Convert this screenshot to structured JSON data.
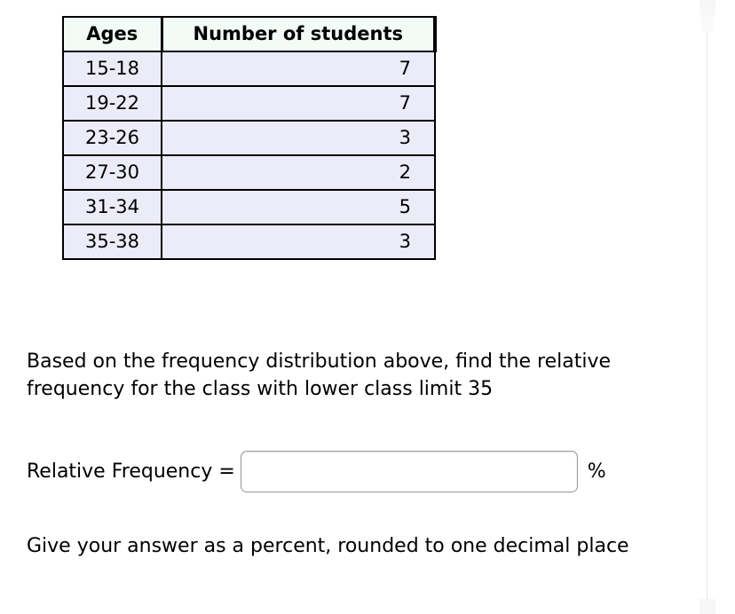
{
  "table": {
    "headers": [
      "Ages",
      "Number of students"
    ],
    "rows": [
      {
        "ages": "15-18",
        "count": "7"
      },
      {
        "ages": "19-22",
        "count": "7"
      },
      {
        "ages": "23-26",
        "count": "3"
      },
      {
        "ages": "27-30",
        "count": "2"
      },
      {
        "ages": "31-34",
        "count": "5"
      },
      {
        "ages": "35-38",
        "count": "3"
      }
    ]
  },
  "question": {
    "prompt": "Based on the frequency distribution above, find the relative frequency for the class with lower class limit 35",
    "answer_label": "Relative Frequency =",
    "answer_value": "",
    "answer_placeholder": "",
    "unit": "%",
    "note": "Give your answer as a percent, rounded to one decimal place"
  },
  "chart_data": {
    "type": "table",
    "title": "",
    "categories": [
      "15-18",
      "19-22",
      "23-26",
      "27-30",
      "31-34",
      "35-38"
    ],
    "values": [
      7,
      7,
      3,
      2,
      5,
      3
    ],
    "xlabel": "Ages",
    "ylabel": "Number of students"
  },
  "colors": {
    "header_bg": "#f2fbf6",
    "cell_bg": "#ecebf8",
    "border": "#000000",
    "input_border": "#999999",
    "page_bg": "#ffffff"
  }
}
